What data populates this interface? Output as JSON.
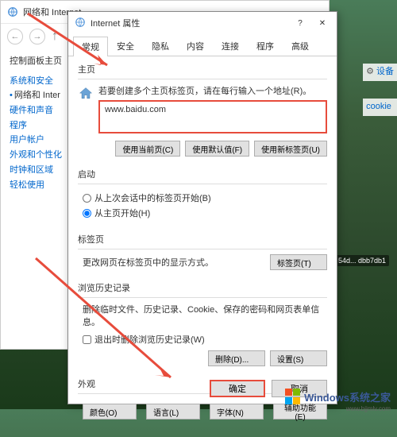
{
  "parent_window": {
    "title": "网络和 Internet"
  },
  "sidebar": {
    "title": "控制面板主页",
    "items": [
      {
        "label": "系统和安全",
        "active": false
      },
      {
        "label": "网络和 Inter",
        "active": true
      },
      {
        "label": "硬件和声音",
        "active": false
      },
      {
        "label": "程序",
        "active": false
      },
      {
        "label": "用户帐户",
        "active": false
      },
      {
        "label": "外观和个性化",
        "active": false
      },
      {
        "label": "时钟和区域",
        "active": false
      },
      {
        "label": "轻松使用",
        "active": false
      }
    ]
  },
  "right_hints": {
    "item1": "设备",
    "item2": "cookie"
  },
  "dialog": {
    "title": "Internet 属性",
    "tabs": [
      "常规",
      "安全",
      "隐私",
      "内容",
      "连接",
      "程序",
      "高级"
    ],
    "active_tab": 0,
    "homepage": {
      "label": "主页",
      "hint": "若要创建多个主页标签页，请在每行输入一个地址(R)。",
      "url": "www.baidu.com",
      "btn_current": "使用当前页(C)",
      "btn_default": "使用默认值(F)",
      "btn_newtab": "使用新标签页(U)"
    },
    "startup": {
      "label": "启动",
      "radio1": "从上次会话中的标签页开始(B)",
      "radio2": "从主页开始(H)"
    },
    "tabpage": {
      "label": "标签页",
      "text": "更改网页在标签页中的显示方式。",
      "btn": "标签页(T)"
    },
    "history": {
      "label": "浏览历史记录",
      "text": "删除临时文件、历史记录、Cookie、保存的密码和网页表单信息。",
      "checkbox": "退出时删除浏览历史记录(W)",
      "btn_delete": "删除(D)...",
      "btn_settings": "设置(S)"
    },
    "appearance": {
      "label": "外观",
      "btn_color": "颜色(O)",
      "btn_lang": "语言(L)",
      "btn_font": "字体(N)",
      "btn_access": "辅助功能(E)"
    },
    "footer": {
      "ok": "确定",
      "cancel": "取消"
    }
  },
  "taskbar": {
    "item": "54d... dbb7db1"
  },
  "watermark": {
    "text": "Windows系统之家",
    "url": "www.bjjmlv.com"
  }
}
